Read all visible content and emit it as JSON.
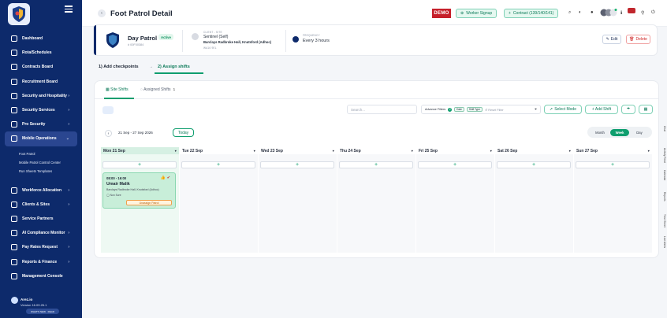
{
  "sidebar": {
    "items": [
      {
        "label": "Dashboard"
      },
      {
        "label": "Rota/Schedules"
      },
      {
        "label": "Contracts Board"
      },
      {
        "label": "Recruitment Board"
      },
      {
        "label": "Security and Hospitality",
        "chev": "›"
      },
      {
        "label": "Security Services",
        "chev": "›"
      },
      {
        "label": "Pro Security",
        "chev": "›"
      },
      {
        "label": "Mobile Operations",
        "chev": "⌄"
      }
    ],
    "sub_items": [
      {
        "label": "Foot Patrol"
      },
      {
        "label": "Mobile Patrol Control Center"
      },
      {
        "label": "Run Sheets Templates"
      }
    ],
    "items_bottom": [
      {
        "label": "Workforce Allocation",
        "chev": "›"
      },
      {
        "label": "Clients & Sites",
        "chev": "›"
      },
      {
        "label": "Service Partners"
      },
      {
        "label": "AI Compliance Monitor",
        "chev": "›"
      },
      {
        "label": "Pay Rates Request",
        "chev": "›"
      },
      {
        "label": "Reports & Finance",
        "chev": "›"
      },
      {
        "label": "Management Console"
      }
    ],
    "footer": {
      "name": "Arez.io",
      "version": "Version 16.09.26.1",
      "whats_new": "WHAT'S NEW  ·  READ"
    }
  },
  "header": {
    "back_icon": "‹",
    "title": "Foot Patrol Detail",
    "demo": "DEMO",
    "worker_signup": "Worker Signup",
    "contract": "Contract (139/140/141)"
  },
  "patrol": {
    "name": "Day Patrol",
    "status": "Active",
    "id": "# 00F00384",
    "client_label": "CLIENT - SITE",
    "client_name": "Sentinel (Self)",
    "site": "Barclays Radbroke Hall, Knutsford (Adhoc)",
    "site_sub": "WA16 9EL",
    "freq_label": "FREQUENCY",
    "freq_value": "Every 3 hours",
    "edit": "Edit",
    "delete": "Delete"
  },
  "steps": {
    "step1": "1) Add checkpoints",
    "sep": "→",
    "step2": "2) Assign shifts"
  },
  "tabs": {
    "site_shifts": "Site Shifts",
    "assigned_shifts": "Assigned Shifts",
    "assigned_count": "1"
  },
  "toolbar": {
    "search_placeholder": "Search...",
    "adv_filters": "Advance Filters",
    "adv_count": "2",
    "chip1": "Date",
    "chip2": "Shift Type",
    "reset": "Reset Filter",
    "select_mode": "Select Mode",
    "add_shift": "+ Add Shift"
  },
  "calendar": {
    "prev": "‹",
    "next": "›",
    "range": "21 Sep - 27 Sep 2026",
    "today": "Today",
    "views": [
      "Month",
      "Week",
      "Day"
    ],
    "selected_view": "Week",
    "days": [
      "Mon 21 Sep",
      "Tue 22 Sep",
      "Wed 23 Sep",
      "Thu 24 Sep",
      "Fri 25 Sep",
      "Sat 26 Sep",
      "Sun 27 Sep"
    ],
    "add_symbol": "+",
    "dropdown_symbol": "▾"
  },
  "shift": {
    "time": "08:00 - 16:00",
    "worker": "Umair Malik",
    "location": "Barclays Radbroke Hall, Knutsford (Adhoc)",
    "note": "◯ Non Sure",
    "unassign": "Unassign Patrol"
  },
  "side_tabs": [
    "Chat",
    "Activity Feed",
    "Calendar",
    "Reports",
    "Time Sheet",
    "Live Alerts"
  ]
}
